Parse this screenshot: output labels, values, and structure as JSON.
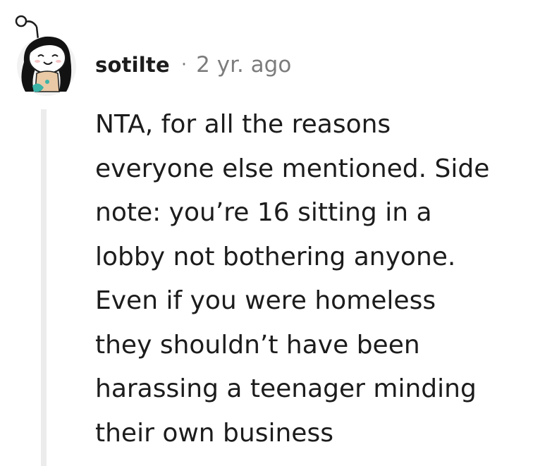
{
  "comment": {
    "username": "sotilte",
    "separator": "·",
    "timestamp": "2 yr. ago",
    "body_lines": [
      "NTA, for all the reasons",
      "everyone else mentioned. Side",
      "note: you’re 16 sitting in a",
      "lobby not bothering anyone.",
      "Even if you were homeless",
      "they shouldn’t have been",
      "harassing a teenager minding",
      "their own business"
    ]
  },
  "icons": {
    "avatar": "user-avatar-snoo-icon"
  },
  "colors": {
    "text": "#1c1c1c",
    "meta": "#7c7c7c",
    "thread_line": "#ececec"
  }
}
